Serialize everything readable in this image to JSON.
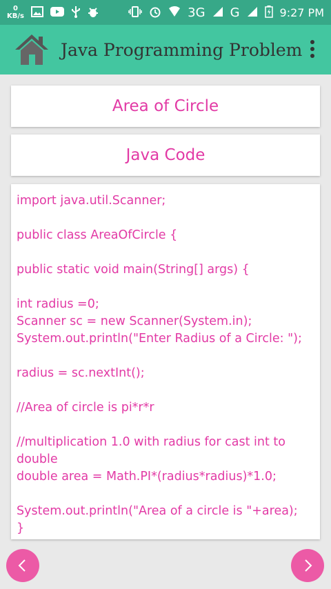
{
  "status_bar": {
    "net_speed_value": "0",
    "net_speed_unit": "KB/s",
    "network_label_1": "3G",
    "network_label_2": "G",
    "time": "9:27 PM"
  },
  "app_bar": {
    "title": "Java Programming Problem",
    "home_icon": "home-icon",
    "menu_icon": "overflow-menu-icon"
  },
  "topic_button": {
    "label": "Area of Circle"
  },
  "code_button": {
    "label": "Java Code"
  },
  "code": "import java.util.Scanner;\n\npublic class AreaOfCircle {\n\npublic static void main(String[] args) {\n\nint radius =0;\nScanner sc = new Scanner(System.in);\nSystem.out.println(\"Enter Radius of a Circle: \");\n\nradius = sc.nextInt();\n\n//Area of circle is pi*r*r\n\n//multiplication 1.0 with radius for cast int to double\ndouble area = Math.PI*(radius*radius)*1.0;\n\nSystem.out.println(\"Area of a circle is \"+area);\n}",
  "colors": {
    "status_bar": "#37a888",
    "app_bar": "#43c6a0",
    "accent": "#e23aa5",
    "nav_button": "#ec5aa6"
  },
  "nav": {
    "prev_icon": "chevron-left-icon",
    "next_icon": "chevron-right-icon"
  }
}
